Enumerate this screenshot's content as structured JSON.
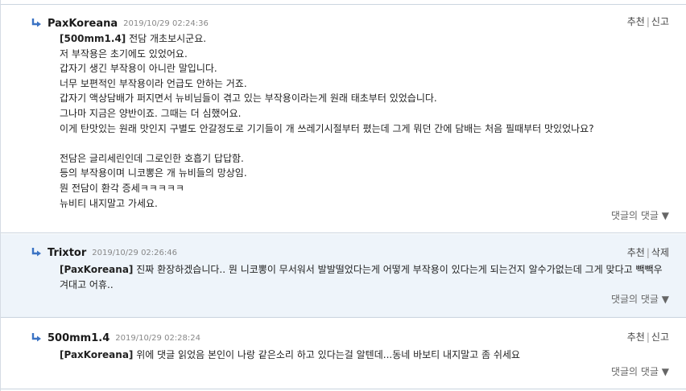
{
  "comments": [
    {
      "author": "PaxKoreana",
      "date": "2019/10/29 02:24:36",
      "action_primary": "추천",
      "action_secondary": "신고",
      "mention": "[500mm1.4]",
      "lines": [
        "전담 개초보시군요.",
        "저 부작용은 초기에도 있었어요.",
        "갑자기 생긴 부작용이 아니란 말입니다.",
        "너무 보편적인 부작용이라 언급도 안하는 거죠.",
        "갑자기 액상담배가 퍼지면서 뉴비님들이 겪고 있는 부작용이라는게 원래 태초부터 있었습니다.",
        "그나마 지금은 양반이죠. 그때는 더 심했어요.",
        "이게 탄맛있는 원래 맛인지 구별도 안갈정도로 기기들이 개 쓰레기시절부터 폈는데 그게 뭐던 간에 담배는 처음 필때부터 맛있었나요?",
        "",
        "전담은 글리세린인데 그로인한 호흡기 답답함.",
        "등의 부작용이며 니코뽕은 개 뉴비들의 망상임.",
        "뭔 전담이 환각 증세ㅋㅋㅋㅋㅋ",
        "뉴비티 내지말고 가세요."
      ],
      "reply_label": "댓글의 댓글 ▼"
    },
    {
      "author": "Trixtor",
      "date": "2019/10/29 02:26:46",
      "action_primary": "추천",
      "action_secondary": "삭제",
      "mention": "[PaxKoreana]",
      "text": "진짜 환장하겠습니다.. 뭔 니코뽕이 무서워서 발발떨었다는게 어떻게 부작용이 있다는게 되는건지 알수가없는데 그게 맞다고 빽빽우겨대고 어휴..",
      "reply_label": "댓글의 댓글 ▼"
    },
    {
      "author": "500mm1.4",
      "date": "2019/10/29 02:28:24",
      "action_primary": "추천",
      "action_secondary": "신고",
      "mention": "[PaxKoreana]",
      "text": "위에 댓글 읽었음 본인이 나랑 같은소리 하고 있다는걸 알텐데...동네 바보티 내지말고 좀 쉬세요",
      "reply_label": "댓글의 댓글 ▼"
    }
  ],
  "colors": {
    "arrow": "#3b73c4",
    "reply_bg": "#eef4fa",
    "border": "#c9d3de"
  },
  "icons": {
    "reply_arrow": "reply-arrow-icon"
  }
}
